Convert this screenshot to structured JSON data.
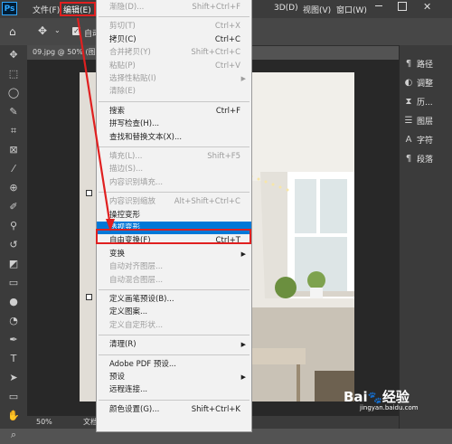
{
  "menubar": {
    "items": [
      "文件(F)",
      "编辑(E)",
      "3D(D)",
      "视图(V)",
      "窗口(W)"
    ],
    "active_index": 1
  },
  "options": {
    "checkbox_label": "自动",
    "move_icon": "move-icon",
    "home_icon": "home-icon"
  },
  "document": {
    "tab_title": "09.jpg @ 50% (图层",
    "zoom": "50%",
    "status_label": "文档"
  },
  "panels": [
    {
      "icon": "paragraph-icon",
      "glyph": "¶",
      "label": "路径"
    },
    {
      "icon": "adjustments-icon",
      "glyph": "◐",
      "label": "调整"
    },
    {
      "icon": "history-icon",
      "glyph": "⧗",
      "label": "历..."
    },
    {
      "icon": "layers-icon",
      "glyph": "☰",
      "label": "图层"
    },
    {
      "icon": "character-icon",
      "glyph": "A",
      "label": "字符"
    },
    {
      "icon": "paragraph-icon",
      "glyph": "¶",
      "label": "段落"
    }
  ],
  "edit_menu": {
    "items": [
      {
        "label": "渐隐(D)...",
        "shortcut": "Shift+Ctrl+F",
        "disabled": true
      },
      {
        "sep": true
      },
      {
        "label": "剪切(T)",
        "shortcut": "Ctrl+X",
        "disabled": true
      },
      {
        "label": "拷贝(C)",
        "shortcut": "Ctrl+C"
      },
      {
        "label": "合并拷贝(Y)",
        "shortcut": "Shift+Ctrl+C",
        "disabled": true
      },
      {
        "label": "粘贴(P)",
        "shortcut": "Ctrl+V",
        "disabled": true
      },
      {
        "label": "选择性粘贴(I)",
        "submenu": true,
        "disabled": true
      },
      {
        "label": "清除(E)",
        "disabled": true
      },
      {
        "sep": true
      },
      {
        "label": "搜索",
        "shortcut": "Ctrl+F"
      },
      {
        "label": "拼写检查(H)..."
      },
      {
        "label": "查找和替换文本(X)..."
      },
      {
        "sep": true
      },
      {
        "label": "填充(L)...",
        "shortcut": "Shift+F5",
        "disabled": true
      },
      {
        "label": "描边(S)...",
        "disabled": true
      },
      {
        "label": "内容识别填充...",
        "disabled": true
      },
      {
        "sep": true
      },
      {
        "label": "内容识别缩放",
        "shortcut": "Alt+Shift+Ctrl+C",
        "disabled": true
      },
      {
        "label": "操控变形"
      },
      {
        "label": "透视变形",
        "highlighted": true
      },
      {
        "label": "自由变换(F)",
        "shortcut": "Ctrl+T"
      },
      {
        "label": "变换",
        "submenu": true
      },
      {
        "label": "自动对齐图层...",
        "disabled": true
      },
      {
        "label": "自动混合图层...",
        "disabled": true
      },
      {
        "sep": true
      },
      {
        "label": "定义画笔预设(B)..."
      },
      {
        "label": "定义图案..."
      },
      {
        "label": "定义自定形状...",
        "disabled": true
      },
      {
        "sep": true
      },
      {
        "label": "清理(R)",
        "submenu": true
      },
      {
        "sep": true
      },
      {
        "label": "Adobe PDF 预设..."
      },
      {
        "label": "预设",
        "submenu": true
      },
      {
        "label": "远程连接..."
      },
      {
        "sep": true
      },
      {
        "label": "颜色设置(G)...",
        "shortcut": "Shift+Ctrl+K"
      }
    ]
  },
  "watermark": {
    "text": "Bai",
    "text2": "经验",
    "sub": "jingyan.baidu.com"
  }
}
